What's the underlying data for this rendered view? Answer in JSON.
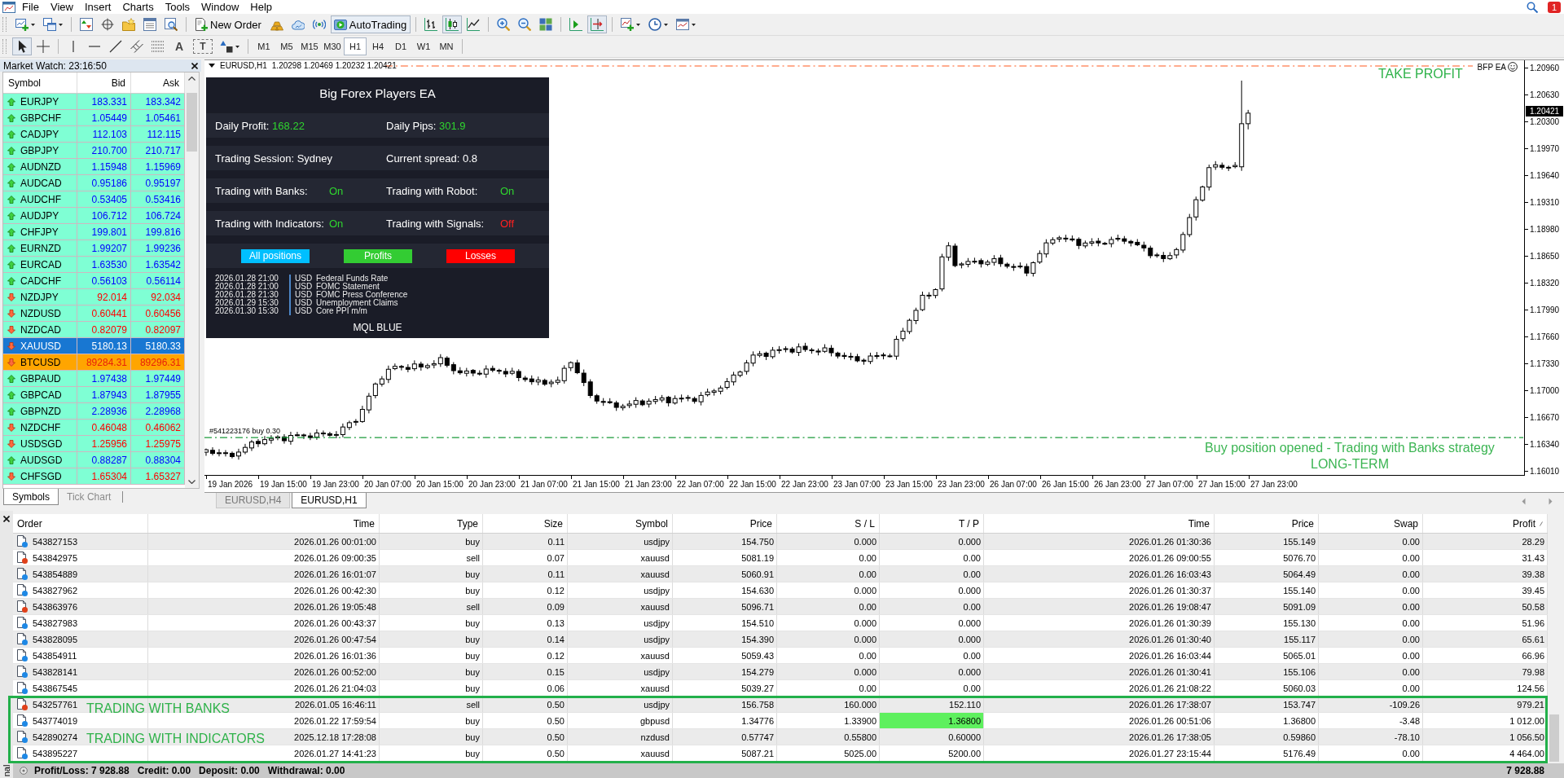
{
  "menu": {
    "items": [
      "File",
      "View",
      "Insert",
      "Charts",
      "Tools",
      "Window",
      "Help"
    ],
    "notifications": "1"
  },
  "toolbar": {
    "new_order": "New Order",
    "autotrading": {
      "label": "AutoTrading",
      "on": true
    },
    "chart_types": [
      {
        "selected": false
      },
      {
        "selected": true
      },
      {
        "selected": false
      }
    ],
    "chart_options": [
      {
        "pressed": false
      },
      {
        "pressed": true
      }
    ]
  },
  "drawing_toolbar": {
    "tools": [
      {
        "selected": true
      },
      {
        "selected": false
      }
    ],
    "text_tool": "A",
    "label_tool": "T",
    "timeframes": [
      {
        "label": "M1",
        "selected": false
      },
      {
        "label": "M5",
        "selected": false
      },
      {
        "label": "M15",
        "selected": false
      },
      {
        "label": "M30",
        "selected": false
      },
      {
        "label": "H1",
        "selected": true
      },
      {
        "label": "H4",
        "selected": false
      },
      {
        "label": "D1",
        "selected": false
      },
      {
        "label": "W1",
        "selected": false
      },
      {
        "label": "MN",
        "selected": false
      }
    ]
  },
  "market_watch": {
    "title": "Market Watch: 23:16:50",
    "columns": [
      "Symbol",
      "Bid",
      "Ask"
    ],
    "rows": [
      {
        "symbol": "EURJPY",
        "bid": "183.331",
        "ask": "183.342",
        "kind": "up",
        "selected": false,
        "highlighted": false
      },
      {
        "symbol": "GBPCHF",
        "bid": "1.05449",
        "ask": "1.05461",
        "kind": "up",
        "selected": false,
        "highlighted": false
      },
      {
        "symbol": "CADJPY",
        "bid": "112.103",
        "ask": "112.115",
        "kind": "up",
        "selected": false,
        "highlighted": false
      },
      {
        "symbol": "GBPJPY",
        "bid": "210.700",
        "ask": "210.717",
        "kind": "up",
        "selected": false,
        "highlighted": false
      },
      {
        "symbol": "AUDNZD",
        "bid": "1.15948",
        "ask": "1.15969",
        "kind": "up",
        "selected": false,
        "highlighted": false
      },
      {
        "symbol": "AUDCAD",
        "bid": "0.95186",
        "ask": "0.95197",
        "kind": "up",
        "selected": false,
        "highlighted": false
      },
      {
        "symbol": "AUDCHF",
        "bid": "0.53405",
        "ask": "0.53416",
        "kind": "up",
        "selected": false,
        "highlighted": false
      },
      {
        "symbol": "AUDJPY",
        "bid": "106.712",
        "ask": "106.724",
        "kind": "up",
        "selected": false,
        "highlighted": false
      },
      {
        "symbol": "CHFJPY",
        "bid": "199.801",
        "ask": "199.816",
        "kind": "up",
        "selected": false,
        "highlighted": false
      },
      {
        "symbol": "EURNZD",
        "bid": "1.99207",
        "ask": "1.99236",
        "kind": "up",
        "selected": false,
        "highlighted": false
      },
      {
        "symbol": "EURCAD",
        "bid": "1.63530",
        "ask": "1.63542",
        "kind": "up",
        "selected": false,
        "highlighted": false
      },
      {
        "symbol": "CADCHF",
        "bid": "0.56103",
        "ask": "0.56114",
        "kind": "up",
        "selected": false,
        "highlighted": false
      },
      {
        "symbol": "NZDJPY",
        "bid": "92.014",
        "ask": "92.034",
        "kind": "down",
        "selected": false,
        "highlighted": false
      },
      {
        "symbol": "NZDUSD",
        "bid": "0.60441",
        "ask": "0.60456",
        "kind": "down",
        "selected": false,
        "highlighted": false
      },
      {
        "symbol": "NZDCAD",
        "bid": "0.82079",
        "ask": "0.82097",
        "kind": "down",
        "selected": false,
        "highlighted": false
      },
      {
        "symbol": "XAUUSD",
        "bid": "5180.13",
        "ask": "5180.33",
        "kind": "down",
        "selected": true,
        "highlighted": false
      },
      {
        "symbol": "BTCUSD",
        "bid": "89284.31",
        "ask": "89296.31",
        "kind": "down",
        "selected": false,
        "highlighted": true
      },
      {
        "symbol": "GBPAUD",
        "bid": "1.97438",
        "ask": "1.97449",
        "kind": "up",
        "selected": false,
        "highlighted": false
      },
      {
        "symbol": "GBPCAD",
        "bid": "1.87943",
        "ask": "1.87955",
        "kind": "up",
        "selected": false,
        "highlighted": false
      },
      {
        "symbol": "GBPNZD",
        "bid": "2.28936",
        "ask": "2.28968",
        "kind": "up",
        "selected": false,
        "highlighted": false
      },
      {
        "symbol": "NZDCHF",
        "bid": "0.46048",
        "ask": "0.46062",
        "kind": "down",
        "selected": false,
        "highlighted": false
      },
      {
        "symbol": "USDSGD",
        "bid": "1.25956",
        "ask": "1.25975",
        "kind": "down",
        "selected": false,
        "highlighted": false
      },
      {
        "symbol": "AUDSGD",
        "bid": "0.88287",
        "ask": "0.88304",
        "kind": "up",
        "selected": false,
        "highlighted": false
      },
      {
        "symbol": "CHFSGD",
        "bid": "1.65304",
        "ask": "1.65327",
        "kind": "down",
        "selected": false,
        "highlighted": false
      }
    ],
    "tabs": [
      {
        "label": "Symbols",
        "selected": true
      },
      {
        "label": "Tick Chart",
        "selected": false
      }
    ]
  },
  "chart": {
    "symbol_period": "EURUSD,H1",
    "ohlc": "1.20298 1.20469 1.20232 1.20421",
    "ea_label": "BFP EA",
    "take_profit_label": "TAKE PROFIT",
    "entry_label": "#541223176 buy 0.30",
    "annotation": [
      "Buy position opened - Trading with Banks strategy",
      "LONG-TERM"
    ],
    "current_price": "1.20421",
    "price_axis": [
      "1.20960",
      "1.20630",
      "1.20300",
      "1.19970",
      "1.19640",
      "1.19310",
      "1.18980",
      "1.18650",
      "1.18320",
      "1.17990",
      "1.17660",
      "1.17330",
      "1.17000",
      "1.16670",
      "1.16340",
      "1.16010"
    ],
    "time_axis": [
      "19 Jan 2026",
      "19 Jan 15:00",
      "19 Jan 23:00",
      "20 Jan 07:00",
      "20 Jan 15:00",
      "20 Jan 23:00",
      "21 Jan 07:00",
      "21 Jan 15:00",
      "21 Jan 23:00",
      "22 Jan 07:00",
      "22 Jan 15:00",
      "22 Jan 23:00",
      "23 Jan 07:00",
      "23 Jan 15:00",
      "23 Jan 23:00",
      "26 Jan 07:00",
      "26 Jan 15:00",
      "26 Jan 23:00",
      "27 Jan 07:00",
      "27 Jan 15:00",
      "27 Jan 23:00"
    ],
    "tabs": [
      {
        "label": "EURUSD,H4",
        "selected": false
      },
      {
        "label": "EURUSD,H1",
        "selected": true
      }
    ]
  },
  "ea_panel": {
    "title": "Big Forex Players EA",
    "stats": [
      {
        "label": "Daily Profit:",
        "value": "168.22"
      },
      {
        "label": "Daily Pips:",
        "value": "301.9"
      }
    ],
    "info": [
      "Trading Session: Sydney",
      "Current spread: 0.8"
    ],
    "switches": [
      {
        "label": "Trading with Banks:",
        "value": "On",
        "on": true
      },
      {
        "label": "Trading with Robot:",
        "value": "On",
        "on": true
      },
      {
        "label": "Trading with Indicators:",
        "value": "On",
        "on": true
      },
      {
        "label": "Trading with Signals:",
        "value": "Off",
        "on": false
      }
    ],
    "buttons": [
      {
        "label": "All positions",
        "color": "#00bfff"
      },
      {
        "label": "Profits",
        "color": "#33cc33"
      },
      {
        "label": "Losses",
        "color": "#ff0000"
      }
    ],
    "events": [
      {
        "time": "2026.01.28 21:00",
        "currency": "USD",
        "name": "Federal Funds Rate"
      },
      {
        "time": "2026.01.28 21:00",
        "currency": "USD",
        "name": "FOMC Statement"
      },
      {
        "time": "2026.01.28 21:30",
        "currency": "USD",
        "name": "FOMC Press Conference"
      },
      {
        "time": "2026.01.29 15:30",
        "currency": "USD",
        "name": "Unemployment Claims"
      },
      {
        "time": "2026.01.30 15:30",
        "currency": "USD",
        "name": "Core PPI m/m"
      }
    ],
    "footer": "MQL BLUE"
  },
  "terminal": {
    "side_tab": "nal",
    "columns": [
      "Order",
      "Time",
      "Type",
      "Size",
      "Symbol",
      "Price",
      "S / L",
      "T / P",
      "Time",
      "Price",
      "Swap",
      "Profit"
    ],
    "rows": [
      {
        "cells": [
          "543827153",
          "2026.01.26 00:01:00",
          "buy",
          "0.11",
          "usdjpy",
          "154.750",
          "0.000",
          "0.000",
          "2026.01.26 01:30:36",
          "155.149",
          "0.00",
          "28.29"
        ],
        "color": "#1e88e5",
        "tp_highlighted": false,
        "framed": false
      },
      {
        "cells": [
          "543842975",
          "2026.01.26 09:00:35",
          "sell",
          "0.07",
          "xauusd",
          "5081.19",
          "0.00",
          "0.00",
          "2026.01.26 09:00:55",
          "5076.70",
          "0.00",
          "31.43"
        ],
        "color": "#e0401a",
        "tp_highlighted": false,
        "framed": false
      },
      {
        "cells": [
          "543854889",
          "2026.01.26 16:01:07",
          "buy",
          "0.11",
          "xauusd",
          "5060.91",
          "0.00",
          "0.00",
          "2026.01.26 16:03:43",
          "5064.49",
          "0.00",
          "39.38"
        ],
        "color": "#1e88e5",
        "tp_highlighted": false,
        "framed": false
      },
      {
        "cells": [
          "543827962",
          "2026.01.26 00:42:30",
          "buy",
          "0.12",
          "usdjpy",
          "154.630",
          "0.000",
          "0.000",
          "2026.01.26 01:30:37",
          "155.140",
          "0.00",
          "39.45"
        ],
        "color": "#1e88e5",
        "tp_highlighted": false,
        "framed": false
      },
      {
        "cells": [
          "543863976",
          "2026.01.26 19:05:48",
          "sell",
          "0.09",
          "xauusd",
          "5096.71",
          "0.00",
          "0.00",
          "2026.01.26 19:08:47",
          "5091.09",
          "0.00",
          "50.58"
        ],
        "color": "#e0401a",
        "tp_highlighted": false,
        "framed": false
      },
      {
        "cells": [
          "543827983",
          "2026.01.26 00:43:37",
          "buy",
          "0.13",
          "usdjpy",
          "154.510",
          "0.000",
          "0.000",
          "2026.01.26 01:30:39",
          "155.130",
          "0.00",
          "51.96"
        ],
        "color": "#1e88e5",
        "tp_highlighted": false,
        "framed": false
      },
      {
        "cells": [
          "543828095",
          "2026.01.26 00:47:54",
          "buy",
          "0.14",
          "usdjpy",
          "154.390",
          "0.000",
          "0.000",
          "2026.01.26 01:30:40",
          "155.117",
          "0.00",
          "65.61"
        ],
        "color": "#1e88e5",
        "tp_highlighted": false,
        "framed": false
      },
      {
        "cells": [
          "543854911",
          "2026.01.26 16:01:36",
          "buy",
          "0.12",
          "xauusd",
          "5059.43",
          "0.00",
          "0.00",
          "2026.01.26 16:03:44",
          "5065.01",
          "0.00",
          "66.96"
        ],
        "color": "#1e88e5",
        "tp_highlighted": false,
        "framed": false
      },
      {
        "cells": [
          "543828141",
          "2026.01.26 00:52:00",
          "buy",
          "0.15",
          "usdjpy",
          "154.279",
          "0.000",
          "0.000",
          "2026.01.26 01:30:41",
          "155.106",
          "0.00",
          "79.98"
        ],
        "color": "#1e88e5",
        "tp_highlighted": false,
        "framed": false
      },
      {
        "cells": [
          "543867545",
          "2026.01.26 21:04:03",
          "buy",
          "0.06",
          "xauusd",
          "5039.27",
          "0.00",
          "0.00",
          "2026.01.26 21:08:22",
          "5060.03",
          "0.00",
          "124.56"
        ],
        "color": "#1e88e5",
        "tp_highlighted": false,
        "framed": false
      },
      {
        "cells": [
          "543257761",
          "2026.01.05 16:46:11",
          "sell",
          "0.50",
          "usdjpy",
          "156.758",
          "160.000",
          "152.110",
          "2026.01.26 17:38:07",
          "153.747",
          "-109.26",
          "979.21"
        ],
        "color": "#e0401a",
        "tp_highlighted": false,
        "framed": true
      },
      {
        "cells": [
          "543774019",
          "2026.01.22 17:59:54",
          "buy",
          "0.50",
          "gbpusd",
          "1.34776",
          "1.33900",
          "1.36800",
          "2026.01.26 00:51:06",
          "1.36800",
          "-3.48",
          "1 012.00"
        ],
        "color": "#1e88e5",
        "tp_highlighted": true,
        "framed": true
      },
      {
        "cells": [
          "542890274",
          "2025.12.18 17:28:08",
          "buy",
          "0.50",
          "nzdusd",
          "0.57747",
          "0.55800",
          "0.60000",
          "2026.01.26 17:38:05",
          "0.59860",
          "-78.10",
          "1 056.50"
        ],
        "color": "#1e88e5",
        "tp_highlighted": false,
        "framed": true
      },
      {
        "cells": [
          "543895227",
          "2026.01.27 14:41:23",
          "buy",
          "0.50",
          "xauusd",
          "5087.21",
          "5025.00",
          "5200.00",
          "2026.01.27 23:15:44",
          "5176.49",
          "0.00",
          "4 464.00"
        ],
        "color": "#1e88e5",
        "tp_highlighted": false,
        "framed": true
      }
    ],
    "annotations": [
      "TRADING WITH BANKS",
      "TRADING WITH INDICATORS"
    ]
  },
  "status_bar": {
    "items": [
      "Profit/Loss: 7 928.88",
      "Credit: 0.00",
      "Deposit: 0.00",
      "Withdrawal: 0.00"
    ],
    "total": "7 928.88"
  }
}
